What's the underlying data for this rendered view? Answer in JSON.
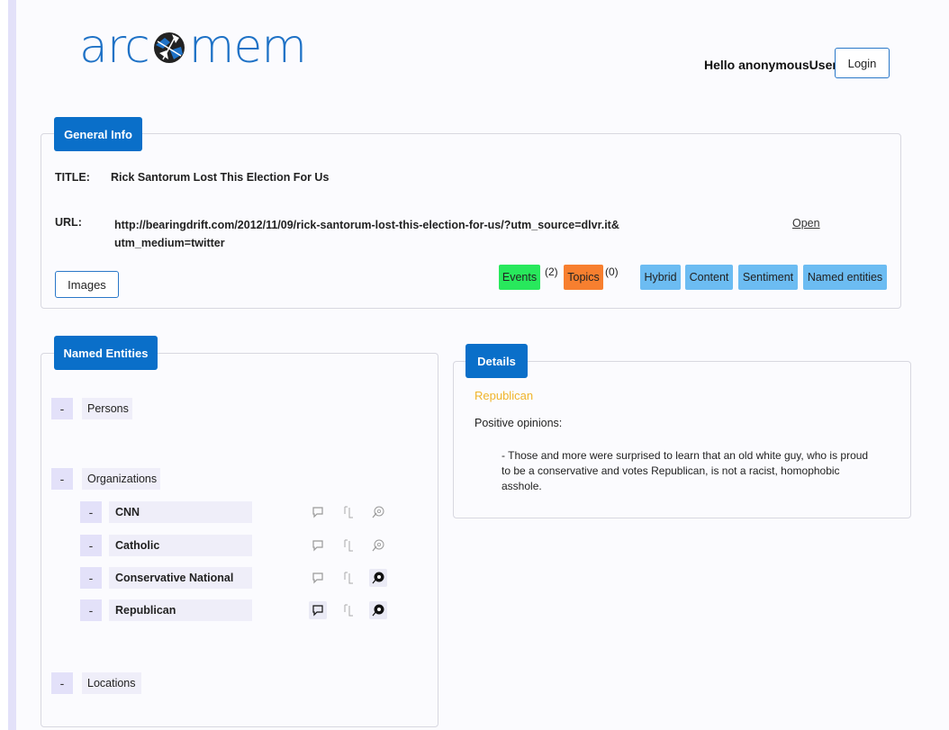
{
  "brand": {
    "logo_left": "arc",
    "logo_right": "mem",
    "color": "#1f72c6"
  },
  "header": {
    "greeting": "Hello anonymousUser",
    "login_label": "Login"
  },
  "general_info": {
    "tab_label": "General Info",
    "title_label": "TITLE:",
    "title_value": "Rick Santorum Lost This Election For Us",
    "url_label": "URL:",
    "url_line1": "http://bearingdrift.com/2012/11/09/rick-santorum-lost-this-election-for-us/?utm_source=dlvr.it&",
    "url_line2": "utm_medium=twitter",
    "open_label": "Open",
    "images_label": "Images",
    "events_label": "Events",
    "events_count": "(2)",
    "topics_label": "Topics",
    "topics_count": "(0)",
    "hybrid_label": "Hybrid",
    "content_label": "Content",
    "sentiment_label": "Sentiment",
    "named_entities_label": "Named entities",
    "colors": {
      "tab": "#0a6fc9",
      "events": "#28e85c",
      "topics": "#f77f2f",
      "blue_tag": "#6cbcf2"
    }
  },
  "named_entities": {
    "tab_label": "Named Entities",
    "toggle_symbol": "-",
    "categories": {
      "persons": "Persons",
      "organizations": "Organizations",
      "locations": "Locations"
    },
    "organizations": [
      {
        "name": "CNN",
        "icons": [
          "comment-icon",
          "tree-icon",
          "sentiment-icon"
        ],
        "active": false
      },
      {
        "name": "Catholic",
        "icons": [
          "comment-icon",
          "tree-icon",
          "sentiment-icon"
        ],
        "active": false
      },
      {
        "name": "Conservative National",
        "icons": [
          "comment-icon",
          "tree-icon",
          "sentiment-icon"
        ],
        "active": false
      },
      {
        "name": "Republican",
        "icons": [
          "comment-icon",
          "tree-icon",
          "sentiment-icon"
        ],
        "active": true
      }
    ]
  },
  "details": {
    "tab_label": "Details",
    "entity": "Republican",
    "entity_color": "#f0b42a",
    "positive_label": "Positive opinions:",
    "quote": "- Those and more were surprised to learn that an old white guy, who is proud to be a conservative and votes Republican, is not a racist, homophobic asshole."
  }
}
